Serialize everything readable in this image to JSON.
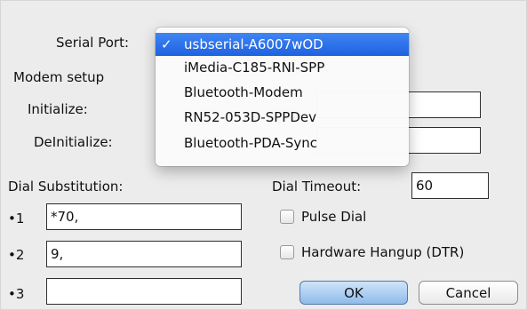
{
  "serial_port": {
    "label": "Serial Port:",
    "options": [
      {
        "label": "usbserial-A6007wOD",
        "selected": true,
        "check": "✓"
      },
      {
        "label": "iMedia-C185-RNI-SPP",
        "selected": false,
        "check": ""
      },
      {
        "label": "Bluetooth-Modem",
        "selected": false,
        "check": ""
      },
      {
        "label": "RN52-053D-SPPDev",
        "selected": false,
        "check": ""
      },
      {
        "label": "Bluetooth-PDA-Sync",
        "selected": false,
        "check": ""
      }
    ]
  },
  "modem_setup": {
    "label": "Modem setup",
    "initialize_label": "Initialize:",
    "initialize_value": "",
    "deinitialize_label": "DeInitialize:",
    "deinitialize_value": ""
  },
  "dial_substitution": {
    "label": "Dial Substitution:",
    "entries": [
      {
        "label": "•1",
        "value": "*70,"
      },
      {
        "label": "•2",
        "value": "9,"
      },
      {
        "label": "•3",
        "value": ""
      }
    ]
  },
  "dial_timeout": {
    "label": "Dial Timeout:",
    "value": "60"
  },
  "options": {
    "pulse_dial_label": "Pulse Dial",
    "pulse_dial_checked": false,
    "hardware_hangup_label": "Hardware Hangup (DTR)",
    "hardware_hangup_checked": false
  },
  "buttons": {
    "ok_label": "OK",
    "cancel_label": "Cancel"
  },
  "colors": {
    "selection": "#2a6fe8",
    "default_button": "#8fbbe9"
  }
}
